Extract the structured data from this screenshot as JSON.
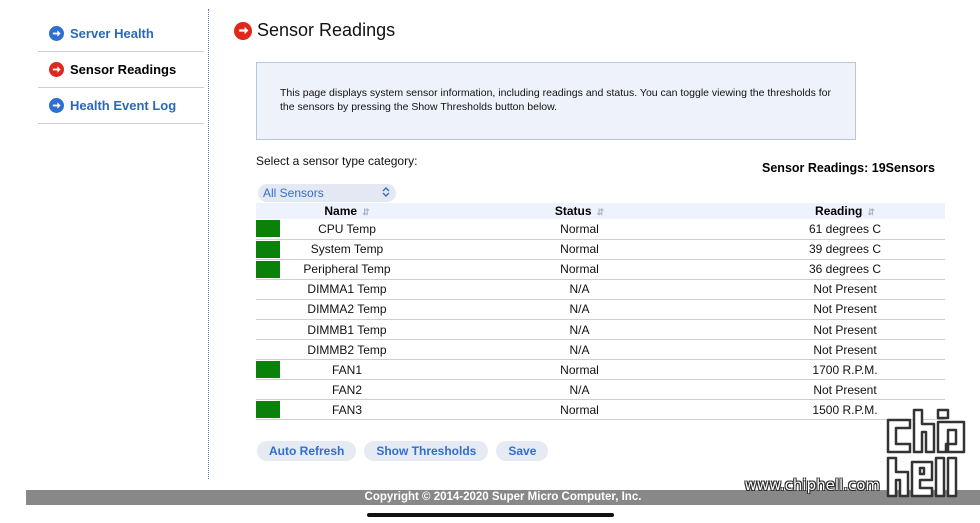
{
  "sidebar": {
    "items": [
      {
        "label": "Server Health"
      },
      {
        "label": "Sensor Readings"
      },
      {
        "label": "Health Event Log"
      }
    ]
  },
  "page": {
    "title": "Sensor Readings",
    "info": "This page displays system sensor information, including readings and status. You can toggle viewing the thresholds for the sensors by pressing the Show Thresholds button below.",
    "select_label": "Select a sensor type category:",
    "selected_category": "All Sensors",
    "count_text": "Sensor Readings: 19Sensors"
  },
  "table": {
    "headers": {
      "name": "Name",
      "status": "Status",
      "reading": "Reading"
    },
    "rows": [
      {
        "indicator": "green",
        "name": "CPU Temp",
        "status": "Normal",
        "reading": "61 degrees C"
      },
      {
        "indicator": "green",
        "name": "System Temp",
        "status": "Normal",
        "reading": "39 degrees C"
      },
      {
        "indicator": "green",
        "name": "Peripheral Temp",
        "status": "Normal",
        "reading": "36 degrees C"
      },
      {
        "indicator": "none",
        "name": "DIMMA1 Temp",
        "status": "N/A",
        "reading": "Not Present"
      },
      {
        "indicator": "none",
        "name": "DIMMA2 Temp",
        "status": "N/A",
        "reading": "Not Present"
      },
      {
        "indicator": "none",
        "name": "DIMMB1 Temp",
        "status": "N/A",
        "reading": "Not Present"
      },
      {
        "indicator": "none",
        "name": "DIMMB2 Temp",
        "status": "N/A",
        "reading": "Not Present"
      },
      {
        "indicator": "green",
        "name": "FAN1",
        "status": "Normal",
        "reading": "1700 R.P.M."
      },
      {
        "indicator": "none",
        "name": "FAN2",
        "status": "N/A",
        "reading": "Not Present"
      },
      {
        "indicator": "green",
        "name": "FAN3",
        "status": "Normal",
        "reading": "1500 R.P.M."
      }
    ]
  },
  "buttons": {
    "auto_refresh": "Auto Refresh",
    "show_thresholds": "Show Thresholds",
    "save": "Save"
  },
  "footer": {
    "copyright": "Copyright © 2014-2020 Super Micro Computer, Inc."
  },
  "watermark": {
    "text": "www.chiphell.com"
  },
  "colors": {
    "status_ok": "#0a820a",
    "link_blue": "#2f6fd0",
    "active_red": "#e0271d"
  }
}
